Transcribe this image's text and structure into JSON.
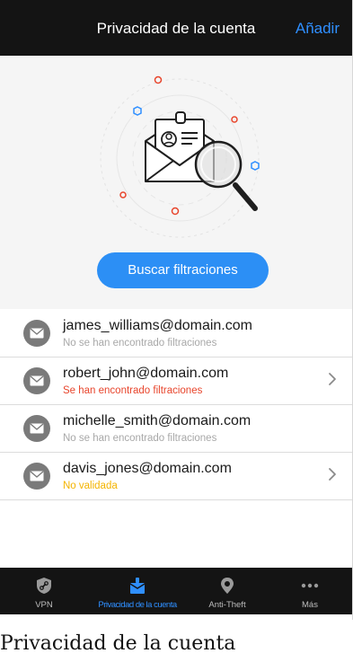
{
  "header": {
    "title": "Privacidad de la cuenta",
    "add_label": "Añadir"
  },
  "hero": {
    "search_button_label": "Buscar filtraciones"
  },
  "accounts": [
    {
      "email": "james_williams@domain.com",
      "status": "No se han encontrado filtraciones",
      "status_color": "#a8a8a8",
      "chevron": false
    },
    {
      "email": "robert_john@domain.com",
      "status": "Se han encontrado filtraciones",
      "status_color": "#e8452c",
      "chevron": true
    },
    {
      "email": "michelle_smith@domain.com",
      "status": "No se han encontrado filtraciones",
      "status_color": "#a8a8a8",
      "chevron": false
    },
    {
      "email": "davis_jones@domain.com",
      "status": "No validada",
      "status_color": "#f4b400",
      "chevron": true
    }
  ],
  "tabbar": {
    "tabs": [
      {
        "label": "VPN",
        "icon": "shield-link-icon",
        "active": false
      },
      {
        "label": "Privacidad de la cuenta",
        "icon": "privacy-envelope-icon",
        "active": true
      },
      {
        "label": "Anti-Theft",
        "icon": "location-pin-icon",
        "active": false
      },
      {
        "label": "Más",
        "icon": "more-dots-icon",
        "active": false
      }
    ]
  },
  "caption": "Privacidad de la cuenta",
  "colors": {
    "accent": "#2f8fff",
    "header_bg": "#141414",
    "hero_bg": "#f5f5f5",
    "danger": "#e8452c",
    "warning": "#f4b400"
  }
}
